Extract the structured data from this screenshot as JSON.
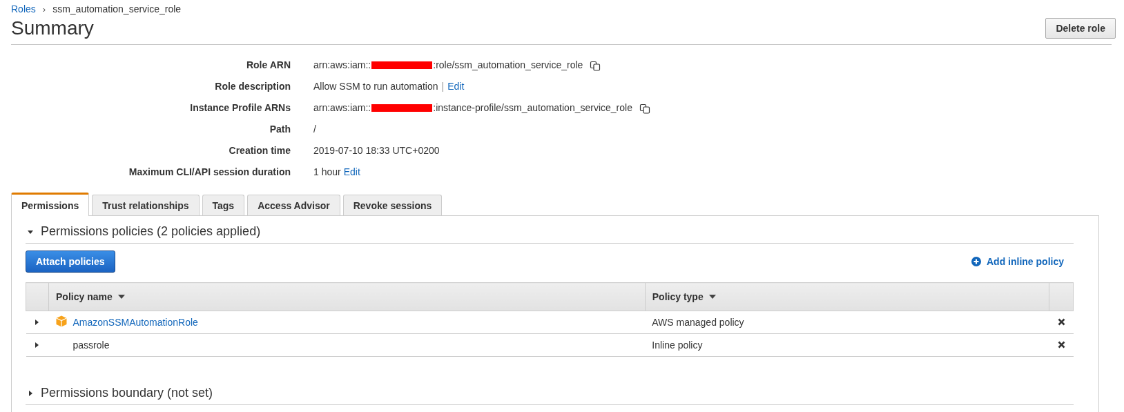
{
  "breadcrumb_separator": "›",
  "breadcrumb": [
    {
      "label": "Roles",
      "link": true
    },
    {
      "label": "ssm_automation_service_role",
      "link": false
    }
  ],
  "title": "Summary",
  "delete_button": "Delete role",
  "details": [
    {
      "label": "Role ARN",
      "kind": "arn",
      "prefix": "arn:aws:iam::",
      "suffix": ":role/ssm_automation_service_role",
      "redacted": true,
      "copy": true
    },
    {
      "label": "Role description",
      "kind": "text",
      "value": "Allow SSM to run automation",
      "separator": "|",
      "edit": "Edit"
    },
    {
      "label": "Instance Profile ARNs",
      "kind": "arn",
      "prefix": "arn:aws:iam::",
      "suffix": ":instance-profile/ssm_automation_service_role",
      "redacted": true,
      "copy": true
    },
    {
      "label": "Path",
      "kind": "text",
      "value": "/"
    },
    {
      "label": "Creation time",
      "kind": "text",
      "value": "2019-07-10 18:33 UTC+0200"
    },
    {
      "label": "Maximum CLI/API session duration",
      "kind": "text",
      "value": "1 hour",
      "edit": "Edit"
    }
  ],
  "tabs": [
    {
      "label": "Permissions",
      "selected": true
    },
    {
      "label": "Trust relationships",
      "selected": false
    },
    {
      "label": "Tags",
      "selected": false
    },
    {
      "label": "Access Advisor",
      "selected": false
    },
    {
      "label": "Revoke sessions",
      "selected": false
    }
  ],
  "policies_section": {
    "title": "Permissions policies (2 policies applied)",
    "expanded": true
  },
  "attach_button": "Attach policies",
  "add_inline": "Add inline policy",
  "table": {
    "columns": [
      "Policy name",
      "Policy type"
    ],
    "rows": [
      {
        "name": "AmazonSSMAutomationRole",
        "type": "AWS managed policy",
        "kind": "managed",
        "expanded": false
      },
      {
        "name": "passrole",
        "type": "Inline policy",
        "kind": "inline",
        "expanded": false
      }
    ]
  },
  "boundary_section": {
    "title": "Permissions boundary (not set)",
    "expanded": false
  }
}
